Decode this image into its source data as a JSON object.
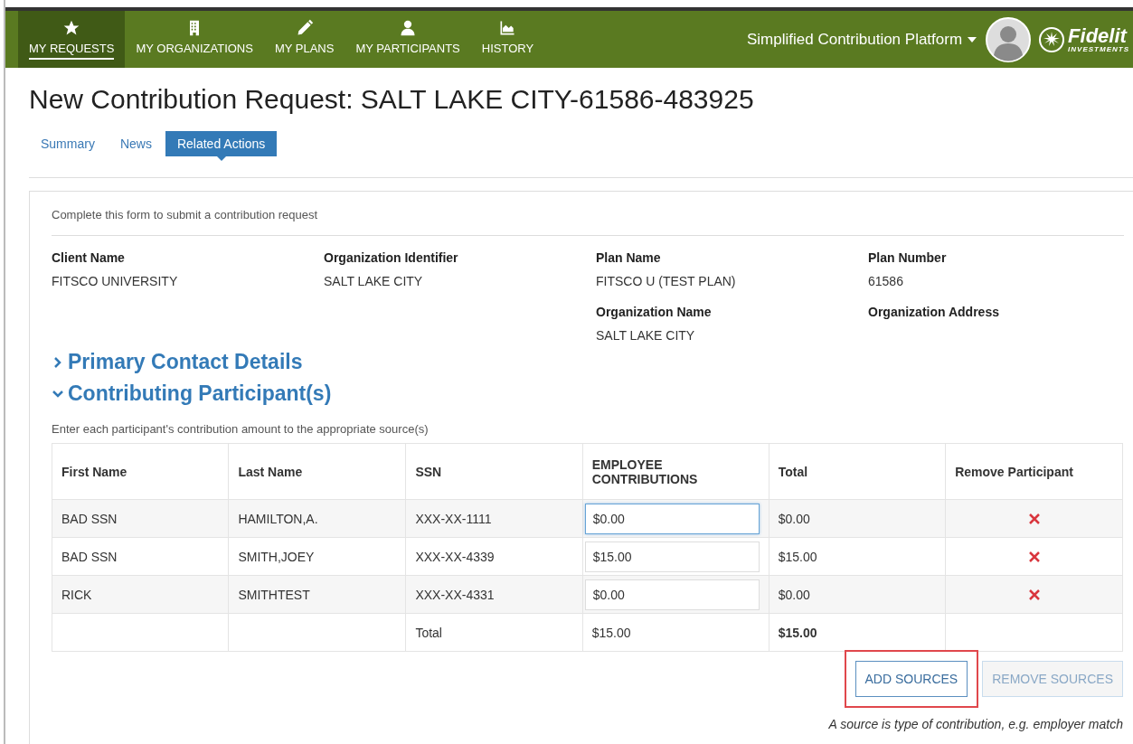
{
  "nav": {
    "items": [
      {
        "label": "MY REQUESTS",
        "selected": true
      },
      {
        "label": "MY ORGANIZATIONS",
        "selected": false
      },
      {
        "label": "MY PLANS",
        "selected": false
      },
      {
        "label": "MY PARTICIPANTS",
        "selected": false
      },
      {
        "label": "HISTORY",
        "selected": false
      }
    ],
    "platform_menu": "Simplified Contribution Platform",
    "logo": {
      "name": "Fidelit",
      "tagline": "INVESTMENTS"
    }
  },
  "title": "New Contribution Request: SALT LAKE CITY-61586-483925",
  "tabs": [
    {
      "label": "Summary",
      "selected": false
    },
    {
      "label": "News",
      "selected": false
    },
    {
      "label": "Related Actions",
      "selected": true
    }
  ],
  "form": {
    "intro": "Complete this form to submit a contribution request",
    "fields": [
      {
        "label": "Client Name",
        "value": "FITSCO UNIVERSITY"
      },
      {
        "label": "Organization Identifier",
        "value": "SALT LAKE CITY"
      },
      {
        "label": "Plan Name",
        "value": "FITSCO U (TEST PLAN)"
      },
      {
        "label": "Plan Number",
        "value": "61586"
      },
      {
        "label": "Organization Name",
        "value": "SALT LAKE CITY"
      },
      {
        "label": "Organization Address"
      }
    ],
    "sections": [
      {
        "title": "Primary Contact Details",
        "expanded": false
      },
      {
        "title": "Contributing Participant(s)",
        "expanded": true
      }
    ],
    "table_hint": "Enter each participant's contribution amount to the appropriate source(s)",
    "table": {
      "columns": [
        "First Name",
        "Last Name",
        "SSN",
        "EMPLOYEE CONTRIBUTIONS",
        "Total",
        "Remove Participant"
      ],
      "rows": [
        {
          "first": "BAD SSN",
          "last": "HAMILTON,A.",
          "ssn": "XXX-XX-1111",
          "amount": "$0.00",
          "focused": true,
          "total": "$0.00"
        },
        {
          "first": "BAD SSN",
          "last": "SMITH,JOEY",
          "ssn": "XXX-XX-4339",
          "amount": "$15.00",
          "focused": false,
          "total": "$15.00"
        },
        {
          "first": "RICK",
          "last": "SMITHTEST",
          "ssn": "XXX-XX-4331",
          "amount": "$0.00",
          "focused": false,
          "total": "$0.00"
        }
      ],
      "footer": {
        "label": "Total",
        "amount": "$15.00",
        "total": "$15.00"
      }
    },
    "buttons": [
      {
        "label": "ADD SOURCES",
        "disabled": false,
        "highlighted": true
      },
      {
        "label": "REMOVE SOURCES",
        "disabled": true,
        "highlighted": false
      }
    ],
    "note": "A source is type of contribution, e.g. employer match"
  }
}
